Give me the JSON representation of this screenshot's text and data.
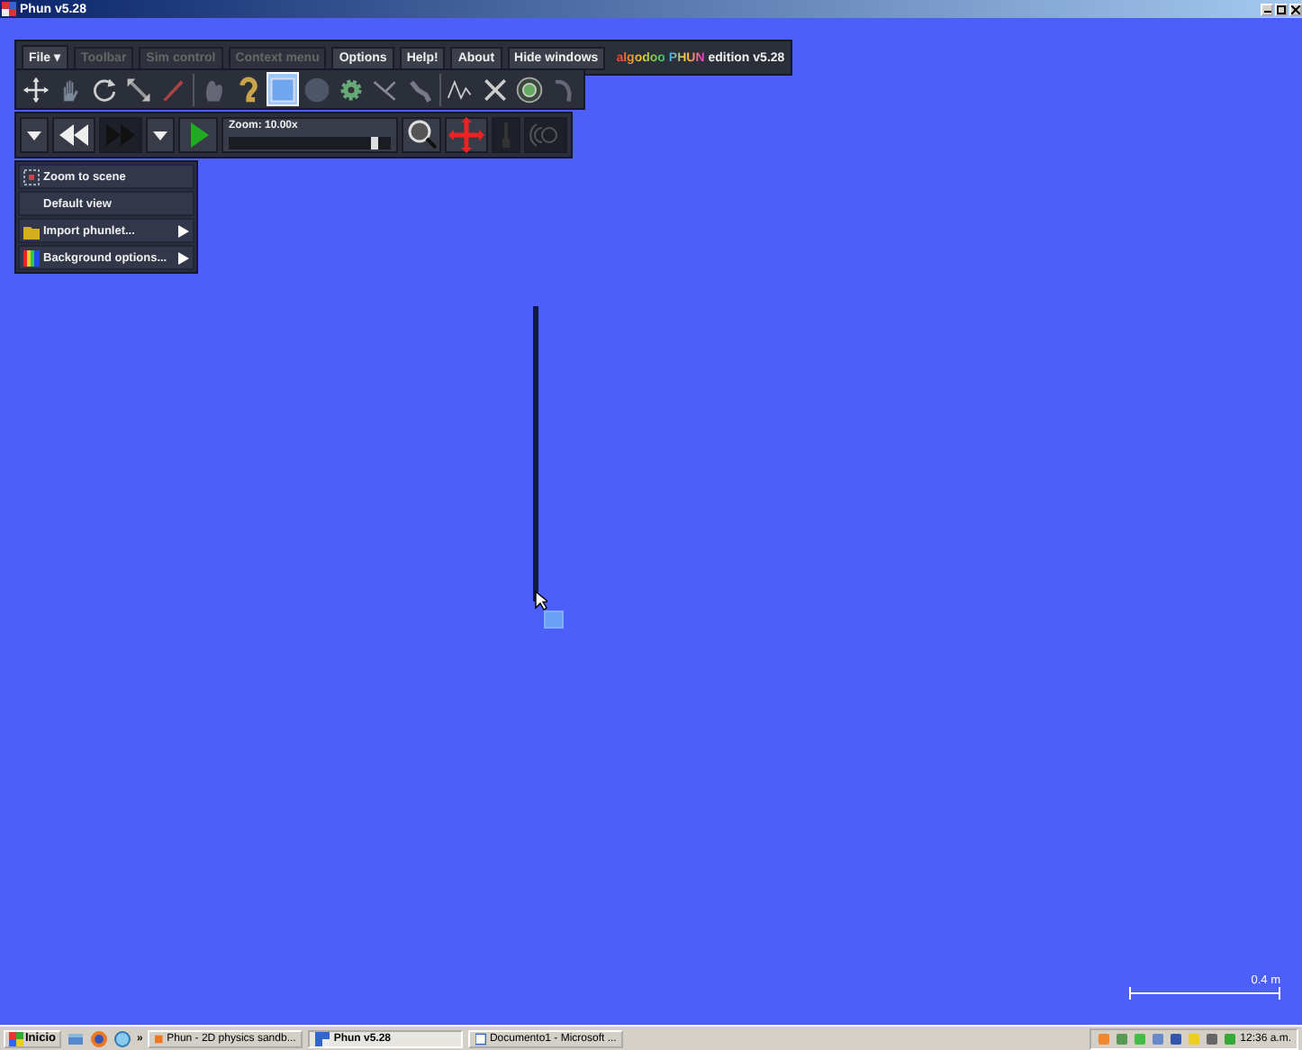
{
  "window": {
    "title": "Phun v5.28"
  },
  "menu_bar": {
    "items": [
      {
        "label": "File ▾",
        "disabled": false
      },
      {
        "label": "Toolbar",
        "disabled": true
      },
      {
        "label": "Sim control",
        "disabled": true
      },
      {
        "label": "Context menu",
        "disabled": true
      },
      {
        "label": "Options",
        "disabled": false
      },
      {
        "label": "Help!",
        "disabled": false
      },
      {
        "label": "About",
        "disabled": false
      },
      {
        "label": "Hide windows",
        "disabled": false
      }
    ],
    "logo": {
      "prefix": "algodoo",
      "brand": "PHUN",
      "suffix": "edition v5.28"
    }
  },
  "toolbar": {
    "groups": [
      [
        {
          "kind": "move",
          "selected": false
        },
        {
          "kind": "hand",
          "selected": false
        },
        {
          "kind": "rotate",
          "selected": false
        },
        {
          "kind": "scale",
          "selected": false
        },
        {
          "kind": "pencil",
          "selected": false
        }
      ],
      [
        {
          "kind": "blob",
          "selected": false
        },
        {
          "kind": "hook",
          "selected": false
        },
        {
          "kind": "box",
          "selected": true
        },
        {
          "kind": "circle",
          "selected": false
        },
        {
          "kind": "gear",
          "selected": false
        },
        {
          "kind": "fork",
          "selected": false
        },
        {
          "kind": "chain",
          "selected": false
        }
      ],
      [
        {
          "kind": "zigzag",
          "selected": false
        },
        {
          "kind": "cross",
          "selected": false
        },
        {
          "kind": "wheel",
          "selected": false
        },
        {
          "kind": "curve",
          "selected": false
        }
      ]
    ]
  },
  "sim_control": {
    "items": [
      {
        "kind": "dropdown",
        "disabled": false
      },
      {
        "kind": "rewind",
        "disabled": false
      },
      {
        "kind": "forward",
        "disabled": true
      },
      {
        "kind": "dropdown",
        "disabled": false
      },
      {
        "kind": "play",
        "disabled": false
      },
      {
        "kind": "zoom",
        "label": "Zoom: 10.00x",
        "level": 0.9,
        "disabled": false
      },
      {
        "kind": "magnifier",
        "disabled": false
      },
      {
        "kind": "target",
        "disabled": false
      },
      {
        "kind": "pin",
        "disabled": true
      },
      {
        "kind": "camera",
        "disabled": true
      }
    ]
  },
  "context_menu": {
    "items": [
      {
        "kind": "zoom",
        "label": "Zoom to scene",
        "submenu": false
      },
      {
        "kind": "plain",
        "label": "Default view",
        "submenu": false
      },
      {
        "kind": "folder",
        "label": "Import phunlet...",
        "submenu": true
      },
      {
        "kind": "palette",
        "label": "Background options...",
        "submenu": true
      }
    ]
  },
  "scale_bar": {
    "label": "0.4 m"
  },
  "taskbar": {
    "start": "Inicio",
    "quick_launch": [
      {
        "kind": "desktop"
      },
      {
        "kind": "globe"
      },
      {
        "kind": "browser"
      }
    ],
    "overflow": "»",
    "tasks": [
      {
        "label": "Phun - 2D physics sandb...",
        "selected": false
      },
      {
        "label": "Phun v5.28",
        "selected": true
      },
      {
        "label": "Documento1 - Microsoft ...",
        "selected": false
      }
    ],
    "clock": "12:36 a.m."
  }
}
